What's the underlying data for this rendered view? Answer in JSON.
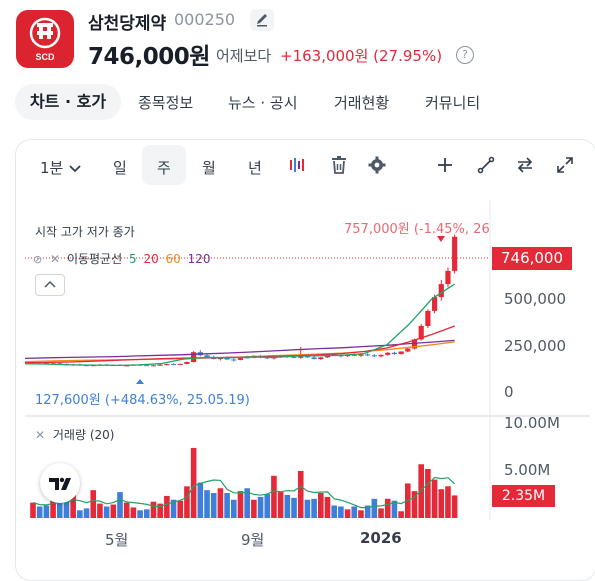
{
  "header": {
    "logo_text": "SCD",
    "name": "삼천당제약",
    "code": "000250",
    "price": "746,000원",
    "vs_label": "어제보다",
    "change": "+163,000원 (27.95%)",
    "info_icon": "?"
  },
  "tabs": [
    "차트 · 호가",
    "종목정보",
    "뉴스 · 공시",
    "거래현황",
    "커뮤니티"
  ],
  "toolbar": {
    "interval": "1분",
    "periods": [
      "일",
      "주",
      "월",
      "년"
    ],
    "selected_period": "주",
    "icons": [
      "candle-type-icon",
      "trash-icon",
      "gear-icon",
      "crosshair-plus-icon",
      "line-draw-icon",
      "compare-icon",
      "expand-icon"
    ]
  },
  "chart": {
    "ohlc_labels": "시작 고가 저가 종가",
    "ma_label": "이동평균선",
    "ma_periods": [
      "5",
      "20",
      "60",
      "120"
    ],
    "ma_colors": [
      "#21a366",
      "#e42939",
      "#f08a1c",
      "#7a2e9e"
    ],
    "high_annotation": "757,000원 (-1.45%, 26",
    "low_annotation": "127,600원 (+484.63%, 25.05.19)",
    "current_price_tag": "746,000",
    "y_ticks": [
      "500,000",
      "250,000",
      "0"
    ],
    "volume_label": "거래량 (20)",
    "volume_ticks": [
      "10.00M",
      "5.00M"
    ],
    "current_volume_tag": "2.35M",
    "x_ticks": [
      "5월",
      "9월",
      "2026"
    ],
    "up_color": "#e42939",
    "down_color": "#3d7fd9"
  },
  "chart_data": {
    "type": "candlestick",
    "ylim": [
      0,
      850000
    ],
    "volume_ylim": [
      0,
      10000000
    ],
    "candles": [
      [
        145000,
        152000,
        140000,
        148000
      ],
      [
        148000,
        150000,
        141000,
        143000
      ],
      [
        143000,
        147000,
        138000,
        140000
      ],
      [
        140000,
        144000,
        136000,
        142000
      ],
      [
        142000,
        146000,
        137000,
        139000
      ],
      [
        139000,
        141000,
        132000,
        134000
      ],
      [
        134000,
        139000,
        130000,
        137000
      ],
      [
        137000,
        140000,
        131000,
        133000
      ],
      [
        133000,
        136000,
        128000,
        130000
      ],
      [
        130000,
        135000,
        127600,
        133000
      ],
      [
        133000,
        138000,
        130000,
        136000
      ],
      [
        136000,
        139000,
        131000,
        132000
      ],
      [
        132000,
        136000,
        129000,
        134000
      ],
      [
        134000,
        137000,
        130000,
        131000
      ],
      [
        131000,
        134000,
        128000,
        132000
      ],
      [
        132000,
        137000,
        130000,
        135000
      ],
      [
        135000,
        138000,
        131000,
        133000
      ],
      [
        133000,
        136000,
        129000,
        130000
      ],
      [
        130000,
        134000,
        128000,
        132000
      ],
      [
        132000,
        136000,
        130000,
        135000
      ],
      [
        135000,
        140000,
        132000,
        138000
      ],
      [
        138000,
        142000,
        134000,
        136000
      ],
      [
        136000,
        140000,
        133000,
        139000
      ],
      [
        139000,
        150000,
        137000,
        148000
      ],
      [
        148000,
        200000,
        146000,
        195000
      ],
      [
        195000,
        205000,
        175000,
        180000
      ],
      [
        180000,
        186000,
        165000,
        170000
      ],
      [
        170000,
        178000,
        160000,
        162000
      ],
      [
        162000,
        170000,
        155000,
        168000
      ],
      [
        168000,
        175000,
        158000,
        160000
      ],
      [
        160000,
        166000,
        150000,
        158000
      ],
      [
        158000,
        172000,
        156000,
        170000
      ],
      [
        170000,
        178000,
        165000,
        168000
      ],
      [
        168000,
        180000,
        166000,
        178000
      ],
      [
        178000,
        182000,
        166000,
        170000
      ],
      [
        170000,
        176000,
        162000,
        165000
      ],
      [
        165000,
        175000,
        160000,
        172000
      ],
      [
        172000,
        182000,
        168000,
        176000
      ],
      [
        176000,
        180000,
        168000,
        172000
      ],
      [
        172000,
        178000,
        166000,
        168000
      ],
      [
        168000,
        220000,
        164000,
        175000
      ],
      [
        175000,
        182000,
        168000,
        170000
      ],
      [
        170000,
        176000,
        160000,
        162000
      ],
      [
        162000,
        172000,
        158000,
        170000
      ],
      [
        170000,
        190000,
        168000,
        185000
      ],
      [
        185000,
        192000,
        176000,
        180000
      ],
      [
        180000,
        186000,
        170000,
        176000
      ],
      [
        176000,
        184000,
        172000,
        182000
      ],
      [
        182000,
        190000,
        176000,
        178000
      ],
      [
        178000,
        186000,
        172000,
        184000
      ],
      [
        184000,
        190000,
        176000,
        180000
      ],
      [
        180000,
        186000,
        172000,
        175000
      ],
      [
        175000,
        184000,
        170000,
        182000
      ],
      [
        182000,
        196000,
        178000,
        192000
      ],
      [
        192000,
        198000,
        182000,
        186000
      ],
      [
        186000,
        200000,
        184000,
        198000
      ],
      [
        198000,
        215000,
        194000,
        212000
      ],
      [
        212000,
        260000,
        208000,
        256000
      ],
      [
        256000,
        330000,
        250000,
        320000
      ],
      [
        320000,
        400000,
        310000,
        392000
      ],
      [
        392000,
        470000,
        380000,
        458000
      ],
      [
        458000,
        540000,
        440000,
        520000
      ],
      [
        520000,
        600000,
        505000,
        583000
      ],
      [
        583000,
        757000,
        570000,
        746000
      ]
    ],
    "volumes": [
      1.6,
      1.2,
      1.3,
      2.0,
      1.9,
      1.7,
      2.6,
      0.8,
      1.0,
      2.9,
      1.5,
      1.2,
      1.4,
      2.7,
      1.6,
      1.1,
      0.8,
      0.9,
      1.7,
      1.5,
      2.3,
      1.9,
      1.8,
      3.3,
      7.3,
      3.7,
      2.9,
      2.6,
      3.1,
      2.6,
      1.9,
      2.8,
      3.1,
      1.9,
      2.2,
      2.5,
      4.4,
      2.7,
      2.4,
      2.1,
      4.9,
      1.9,
      2.0,
      2.6,
      2.2,
      1.3,
      1.2,
      0.9,
      1.2,
      0.8,
      1.3,
      2.0,
      1.0,
      2.0,
      1.8,
      0.7,
      3.6,
      2.8,
      5.6,
      5.1,
      4.0,
      3.0,
      3.3,
      2.35
    ],
    "ma_120": [
      165000,
      168000,
      170000,
      172000,
      174000,
      177000,
      180000,
      183000,
      187000,
      191000,
      196000,
      201000,
      207000,
      212000,
      216000,
      222000,
      228000,
      236000,
      243000,
      251000
    ],
    "ma_60": [
      150000,
      153000,
      155000,
      157000,
      158000,
      160000,
      162000,
      164000,
      167000,
      170000,
      174000,
      178000,
      182000,
      186000,
      190000,
      198000,
      207000,
      218000,
      230000,
      244000
    ],
    "ma_20": [
      144000,
      146000,
      148000,
      152000,
      156000,
      160000,
      164000,
      166000,
      168000,
      170000,
      172000,
      175000,
      178000,
      182000,
      188000,
      198000,
      215000,
      245000,
      280000,
      320000
    ],
    "ma_5": [
      140000,
      138000,
      134000,
      133000,
      132000,
      134000,
      140000,
      162000,
      170000,
      168000,
      172000,
      170000,
      176000,
      178000,
      180000,
      188000,
      230000,
      330000,
      450000,
      520000
    ]
  }
}
